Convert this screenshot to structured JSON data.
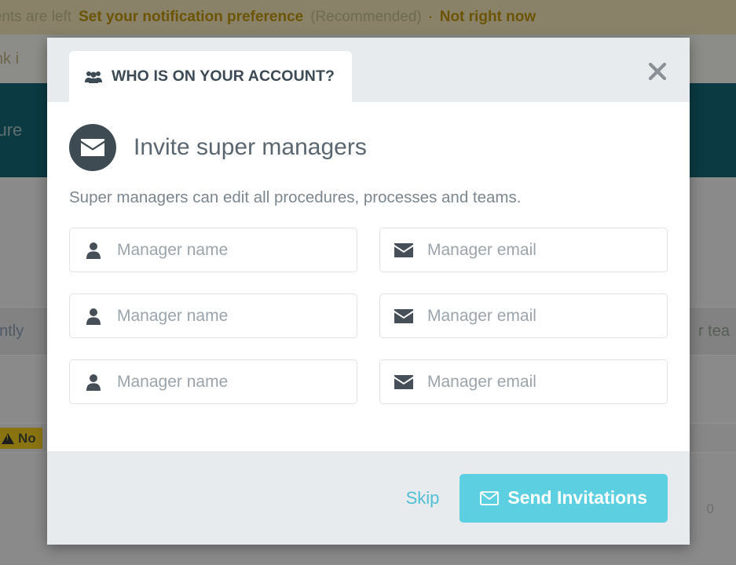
{
  "background": {
    "notification_bar": {
      "lead_text": "ments are left",
      "link_text": "Set your notification preference",
      "paren_text": "(Recommended)",
      "separator": "·",
      "dismiss_text": "Not right now"
    },
    "rows": [
      {
        "left_text": "link i"
      },
      {
        "left_text": "edure"
      },
      {
        "left_text": ""
      },
      {
        "left_text": "ently",
        "right_text": "r tea"
      },
      {
        "left_text": ""
      },
      {
        "left_text": "",
        "count_text": "0"
      }
    ],
    "warning_badge": {
      "icon": "warning-triangle-icon",
      "label": "No"
    }
  },
  "modal": {
    "tab": {
      "icon": "users-group-icon",
      "label": "WHO IS ON YOUR ACCOUNT?"
    },
    "close_icon": "close-icon",
    "title": {
      "icon": "envelope-icon",
      "text": "Invite super managers"
    },
    "subtitle": "Super managers can edit all procedures, processes and teams.",
    "fields": [
      {
        "name": {
          "icon": "person-icon",
          "placeholder": "Manager name",
          "value": ""
        },
        "email": {
          "icon": "envelope-icon",
          "placeholder": "Manager email",
          "value": ""
        }
      },
      {
        "name": {
          "icon": "person-icon",
          "placeholder": "Manager name",
          "value": ""
        },
        "email": {
          "icon": "envelope-icon",
          "placeholder": "Manager email",
          "value": ""
        }
      },
      {
        "name": {
          "icon": "person-icon",
          "placeholder": "Manager name",
          "value": ""
        },
        "email": {
          "icon": "envelope-icon",
          "placeholder": "Manager email",
          "value": ""
        }
      }
    ],
    "footer": {
      "skip_label": "Skip",
      "send_icon": "envelope-icon",
      "send_label": "Send Invitations"
    }
  },
  "colors": {
    "accent": "#5ccfe0",
    "link": "#4fbfd4",
    "header_bg": "#e8ebee",
    "title_badge": "#3f4b53",
    "banner_bg": "#8a8268",
    "teal_band": "#0b3a42"
  }
}
